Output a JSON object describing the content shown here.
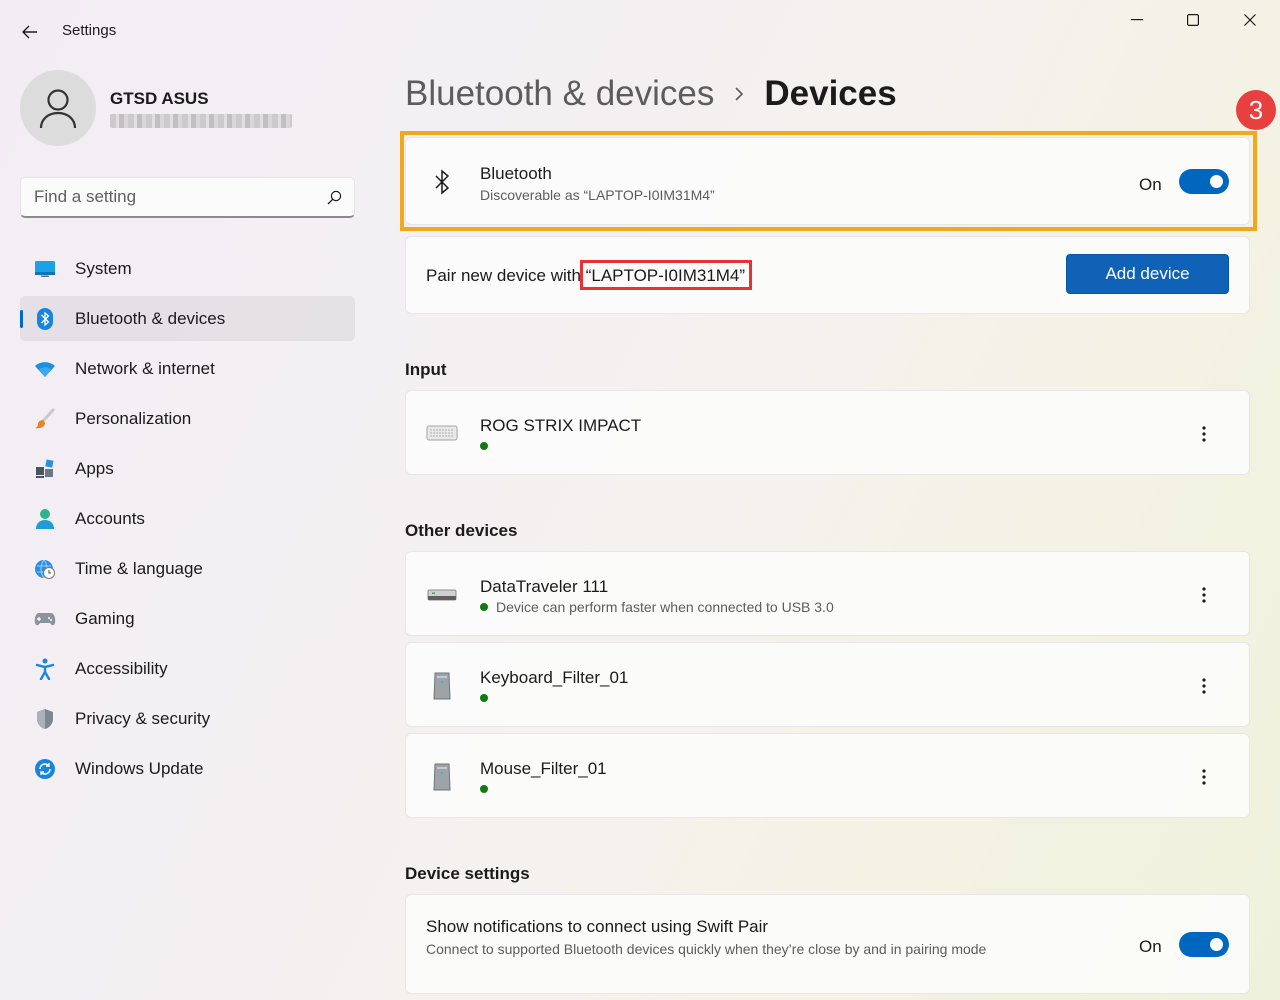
{
  "window": {
    "title": "Settings",
    "back_icon": "back-arrow-icon",
    "controls": [
      "minimize-icon",
      "maximize-icon",
      "close-icon"
    ]
  },
  "user": {
    "name": "GTSD ASUS",
    "email": ""
  },
  "search": {
    "placeholder": "Find a setting",
    "value": ""
  },
  "sidebar": {
    "items": [
      {
        "label": "System",
        "icon": "system-icon"
      },
      {
        "label": "Bluetooth & devices",
        "icon": "bluetooth-icon",
        "active": true
      },
      {
        "label": "Network & internet",
        "icon": "wifi-icon"
      },
      {
        "label": "Personalization",
        "icon": "brush-icon"
      },
      {
        "label": "Apps",
        "icon": "apps-icon"
      },
      {
        "label": "Accounts",
        "icon": "accounts-icon"
      },
      {
        "label": "Time & language",
        "icon": "globe-clock-icon"
      },
      {
        "label": "Gaming",
        "icon": "gamepad-icon"
      },
      {
        "label": "Accessibility",
        "icon": "accessibility-icon"
      },
      {
        "label": "Privacy & security",
        "icon": "shield-icon"
      },
      {
        "label": "Windows Update",
        "icon": "update-icon"
      }
    ]
  },
  "breadcrumb": {
    "parent": "Bluetooth & devices",
    "separator": "›",
    "current": "Devices"
  },
  "step_badge": "3",
  "bluetooth": {
    "title": "Bluetooth",
    "subtitle": "Discoverable as “LAPTOP-I0IM31M4”",
    "state_label": "On",
    "on": true
  },
  "pair": {
    "label": "Pair new device with",
    "device_name": "“LAPTOP-I0IM31M4”",
    "button": "Add device"
  },
  "input_section": {
    "title": "Input",
    "devices": [
      {
        "name": "ROG STRIX IMPACT",
        "icon": "keyboard-icon",
        "status": "connected"
      }
    ]
  },
  "other_section": {
    "title": "Other devices",
    "devices": [
      {
        "name": "DataTraveler 111",
        "icon": "usb-drive-icon",
        "status_text": "Device can perform faster when connected to USB 3.0"
      },
      {
        "name": "Keyboard_Filter_01",
        "icon": "device-tower-icon",
        "status_text": ""
      },
      {
        "name": "Mouse_Filter_01",
        "icon": "device-tower-icon",
        "status_text": ""
      }
    ]
  },
  "device_settings": {
    "title": "Device settings",
    "swift_pair": {
      "title": "Show notifications to connect using Swift Pair",
      "description": "Connect to supported Bluetooth devices quickly when they’re close by and in pairing mode",
      "state_label": "On",
      "on": true
    }
  },
  "colors": {
    "accent": "#0067c0",
    "highlight_box": "#f1a81b",
    "callout_red": "#e53335",
    "status_green": "#0f7b0f"
  }
}
